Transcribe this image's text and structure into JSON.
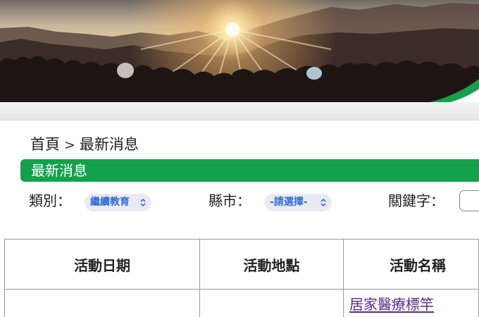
{
  "banner": {
    "image_name": "sunrise-crowd-banner",
    "accent_color": "#14a14c"
  },
  "breadcrumb": {
    "home": "首頁",
    "separator": ">",
    "current": "最新消息"
  },
  "title_bar": {
    "label": "最新消息",
    "color": "#14a14c"
  },
  "filters": {
    "category_label": "類別：",
    "category_value": "繼續教育",
    "city_label": "縣市：",
    "city_value": "-請選擇-",
    "keyword_label": "關鍵字：",
    "keyword_value": ""
  },
  "table": {
    "columns": [
      "活動日期",
      "活動地點",
      "活動名稱"
    ],
    "rows": [
      {
        "date": "",
        "location": "",
        "name": "居家醫療標竿"
      }
    ]
  }
}
